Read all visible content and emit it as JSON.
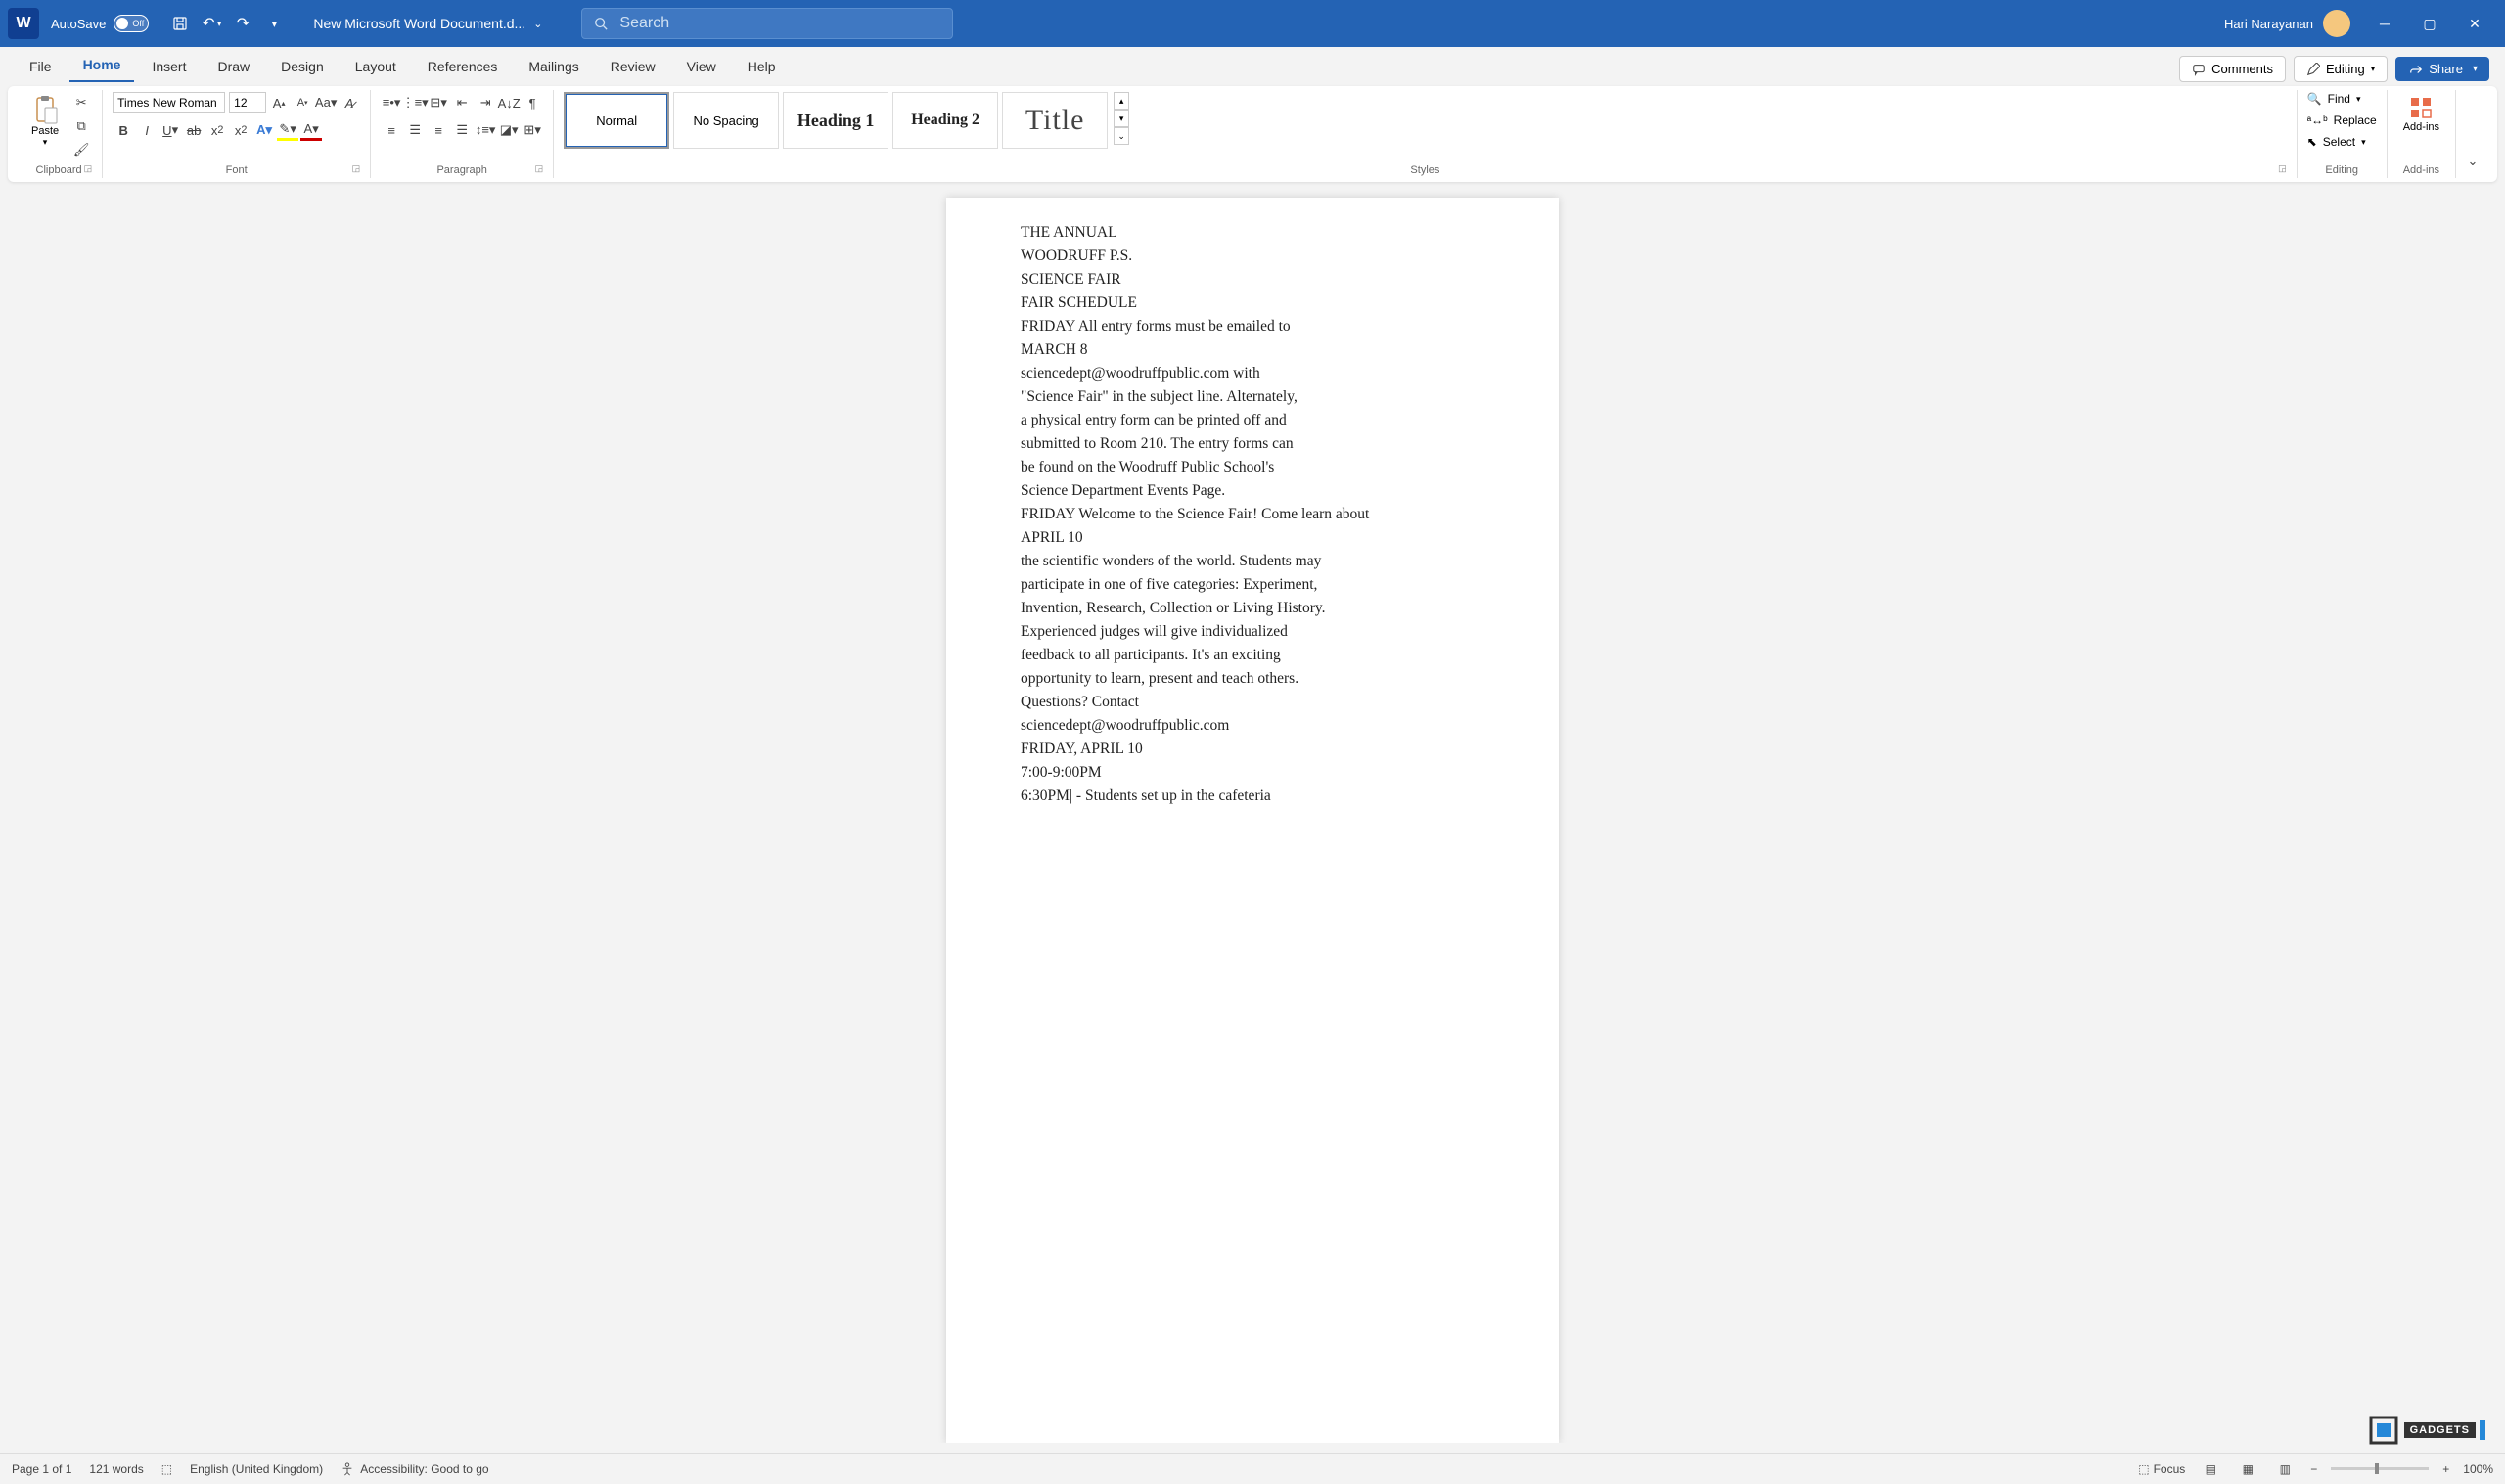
{
  "titleBar": {
    "autoSave": "AutoSave",
    "autoSaveOff": "Off",
    "docName": "New Microsoft Word Document.d...",
    "searchPlaceholder": "Search",
    "userName": "Hari Narayanan"
  },
  "tabs": [
    "File",
    "Home",
    "Insert",
    "Draw",
    "Design",
    "Layout",
    "References",
    "Mailings",
    "Review",
    "View",
    "Help"
  ],
  "activeTab": "Home",
  "topRight": {
    "comments": "Comments",
    "editing": "Editing",
    "share": "Share"
  },
  "ribbon": {
    "clipboard": {
      "paste": "Paste",
      "label": "Clipboard"
    },
    "font": {
      "name": "Times New Roman",
      "size": "12",
      "label": "Font"
    },
    "paragraph": {
      "label": "Paragraph"
    },
    "styles": {
      "label": "Styles",
      "items": [
        "Normal",
        "No Spacing",
        "Heading 1",
        "Heading 2",
        "Title"
      ]
    },
    "editing": {
      "find": "Find",
      "replace": "Replace",
      "select": "Select",
      "label": "Editing"
    },
    "addins": {
      "label": "Add-ins",
      "text": "Add-ins"
    }
  },
  "document": {
    "lines": [
      "THE ANNUAL",
      "WOODRUFF P.S.",
      "SCIENCE FAIR",
      "FAIR SCHEDULE",
      "FRIDAY All entry forms must be emailed to",
      "MARCH 8",
      "sciencedept@woodruffpublic.com with",
      "\"Science Fair\" in the subject line. Alternately,",
      "a physical entry form can be printed off and",
      "submitted to Room 210. The entry forms can",
      "be found on the Woodruff Public School's",
      "Science Department Events Page.",
      "FRIDAY Welcome to the Science Fair! Come learn about",
      "APRIL 10",
      "the scientific wonders of the world. Students may",
      "participate in one of five categories: Experiment,",
      "Invention, Research, Collection or Living History.",
      "Experienced judges will give individualized",
      "feedback to all participants. It's an exciting",
      "opportunity to learn, present and teach others.",
      "Questions? Contact",
      "sciencedept@woodruffpublic.com",
      "FRIDAY, APRIL 10",
      "7:00-9:00PM",
      "6:30PM| - Students set up in the cafeteria"
    ]
  },
  "statusBar": {
    "page": "Page 1 of 1",
    "words": "121 words",
    "language": "English (United Kingdom)",
    "accessibility": "Accessibility: Good to go",
    "focus": "Focus",
    "zoom": "100%"
  },
  "watermark": "GADGETS"
}
